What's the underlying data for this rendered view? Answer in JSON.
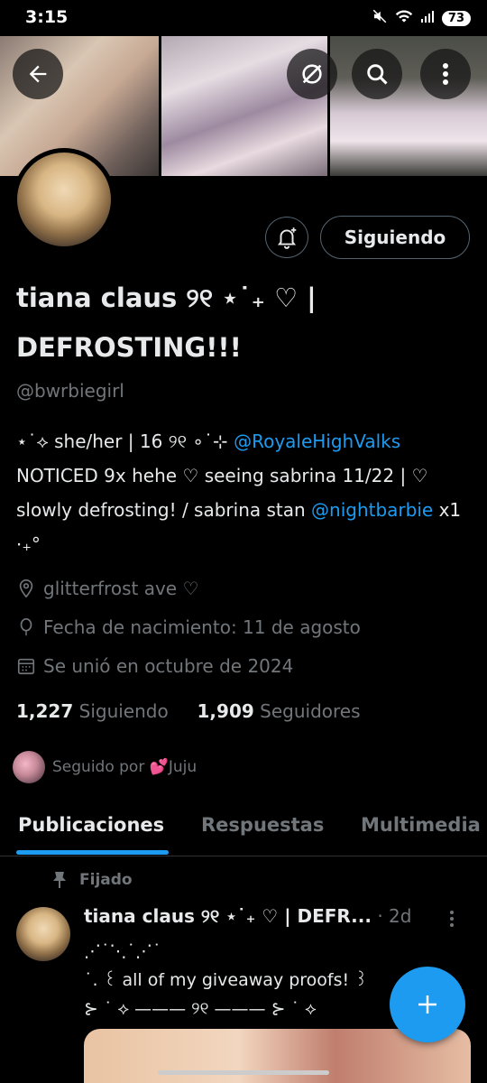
{
  "status_bar": {
    "time": "3:15",
    "battery": "73"
  },
  "profile": {
    "display_name": "tiana claus ୨୧ ⋆˙₊ ♡ | DEFROSTING!!!",
    "handle": "@bwrbiegirl",
    "bio": {
      "line1_text": "⋆˙⟡ she/her | 16 ୨୧ ∘˙⊹ ",
      "line1_link": "@RoyaleHighValks",
      "line2_text": "NOTICED 9x hehe ♡ seeing sabrina 11/22 | ♡ slowly defrosting! / sabrina stan ",
      "line3_link": "@nightbarbie",
      "line3_text": " x1 ⋅₊°"
    },
    "location": "glitterfrost ave ♡",
    "birthday": "Fecha de nacimiento: 11 de agosto",
    "joined": "Se unió en octubre de 2024",
    "following_count": "1,227",
    "following_label": "Siguiendo",
    "followers_count": "1,909",
    "followers_label": "Seguidores",
    "followed_by": "Seguido por 💕Juju"
  },
  "actions": {
    "following_button": "Siguiendo"
  },
  "tabs": [
    {
      "label": "Publicaciones",
      "active": true
    },
    {
      "label": "Respuestas",
      "active": false
    },
    {
      "label": "Multimedia",
      "active": false
    }
  ],
  "pinned_post": {
    "pinned_label": "Fijado",
    "author": "tiana claus ୨୧ ⋆˙₊ ♡ | DEFR...",
    "time": "2d",
    "text": "⋰˙⋱˙⋰˙\n ˙. ꒰ all of my giveaway proofs! ꒱\n⊱ ˙ ⟡ ——— ୨୧ ——— ⊱ ˙ ⟡"
  },
  "colors": {
    "accent": "#1d9bf0",
    "background": "#000000",
    "muted": "#71767b",
    "border": "#2f3336"
  },
  "icons": [
    "back-arrow-icon",
    "grok-icon",
    "search-icon",
    "more-vertical-icon",
    "bell-plus-icon",
    "location-icon",
    "balloon-icon",
    "calendar-icon",
    "pin-icon",
    "plus-icon"
  ]
}
